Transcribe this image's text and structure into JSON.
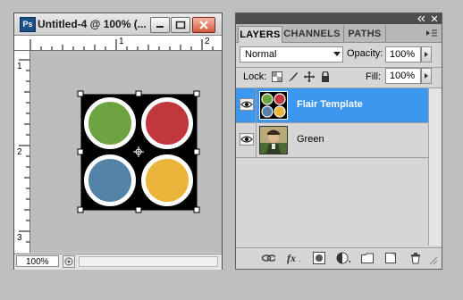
{
  "document": {
    "app_badge": "Ps",
    "title": "Untitled-4 @ 100% (...",
    "zoom": "100%",
    "ruler_top_numbers": [
      "1",
      "2"
    ],
    "ruler_left_numbers": [
      "1",
      "2",
      "3"
    ],
    "artwork": {
      "background": "#000000",
      "circle_colors": [
        "#6ea341",
        "#c2373d",
        "#5383a6",
        "#ebb53b"
      ]
    }
  },
  "layers_panel": {
    "tabs": [
      {
        "label": "LAYERS",
        "active": true
      },
      {
        "label": "CHANNELS",
        "active": false
      },
      {
        "label": "PATHS",
        "active": false
      }
    ],
    "blend_mode": "Normal",
    "opacity_label": "Opacity:",
    "opacity_value": "100%",
    "lock_label": "Lock:",
    "fill_label": "Fill:",
    "fill_value": "100%",
    "layers": [
      {
        "name": "Flair Template",
        "selected": true,
        "visible": true
      },
      {
        "name": "Green",
        "selected": false,
        "visible": true
      }
    ],
    "selected_color": "#3c97ef"
  }
}
